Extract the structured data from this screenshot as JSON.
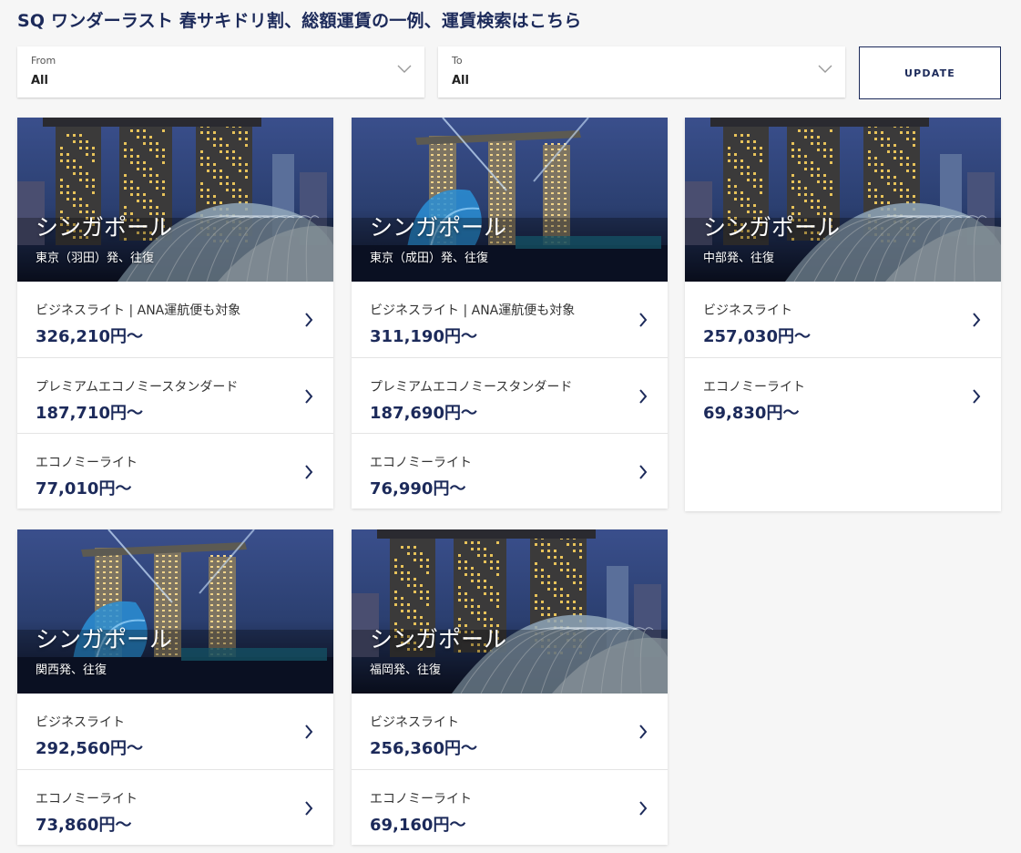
{
  "page": {
    "title": "SQ ワンダーラスト 春サキドリ割、総額運賃の一例、運賃検索はこちら"
  },
  "filters": {
    "from": {
      "label": "From",
      "value": "All"
    },
    "to": {
      "label": "To",
      "value": "All"
    },
    "update_label": "UPDATE"
  },
  "colors": {
    "brand_navy": "#1c2a5a",
    "background": "#f6f6f6",
    "card": "#ffffff"
  },
  "cards": [
    {
      "destination": "シンガポール",
      "origin": "東京（羽田）発、往復",
      "fares": [
        {
          "class": "ビジネスライト | ANA運航便も対象",
          "price": "326,210円〜"
        },
        {
          "class": "プレミアムエコノミースタンダード",
          "price": "187,710円〜"
        },
        {
          "class": "エコノミーライト",
          "price": "77,010円〜"
        }
      ]
    },
    {
      "destination": "シンガポール",
      "origin": "東京（成田）発、往復",
      "fares": [
        {
          "class": "ビジネスライト | ANA運航便も対象",
          "price": "311,190円〜"
        },
        {
          "class": "プレミアムエコノミースタンダード",
          "price": "187,690円〜"
        },
        {
          "class": "エコノミーライト",
          "price": "76,990円〜"
        }
      ]
    },
    {
      "destination": "シンガポール",
      "origin": "中部発、往復",
      "fares": [
        {
          "class": "ビジネスライト",
          "price": "257,030円〜"
        },
        {
          "class": "エコノミーライト",
          "price": "69,830円〜"
        }
      ]
    },
    {
      "destination": "シンガポール",
      "origin": "関西発、往復",
      "fares": [
        {
          "class": "ビジネスライト",
          "price": "292,560円〜"
        },
        {
          "class": "エコノミーライト",
          "price": "73,860円〜"
        }
      ]
    },
    {
      "destination": "シンガポール",
      "origin": "福岡発、往復",
      "fares": [
        {
          "class": "ビジネスライト",
          "price": "256,360円〜"
        },
        {
          "class": "エコノミーライト",
          "price": "69,160円〜"
        }
      ]
    }
  ]
}
